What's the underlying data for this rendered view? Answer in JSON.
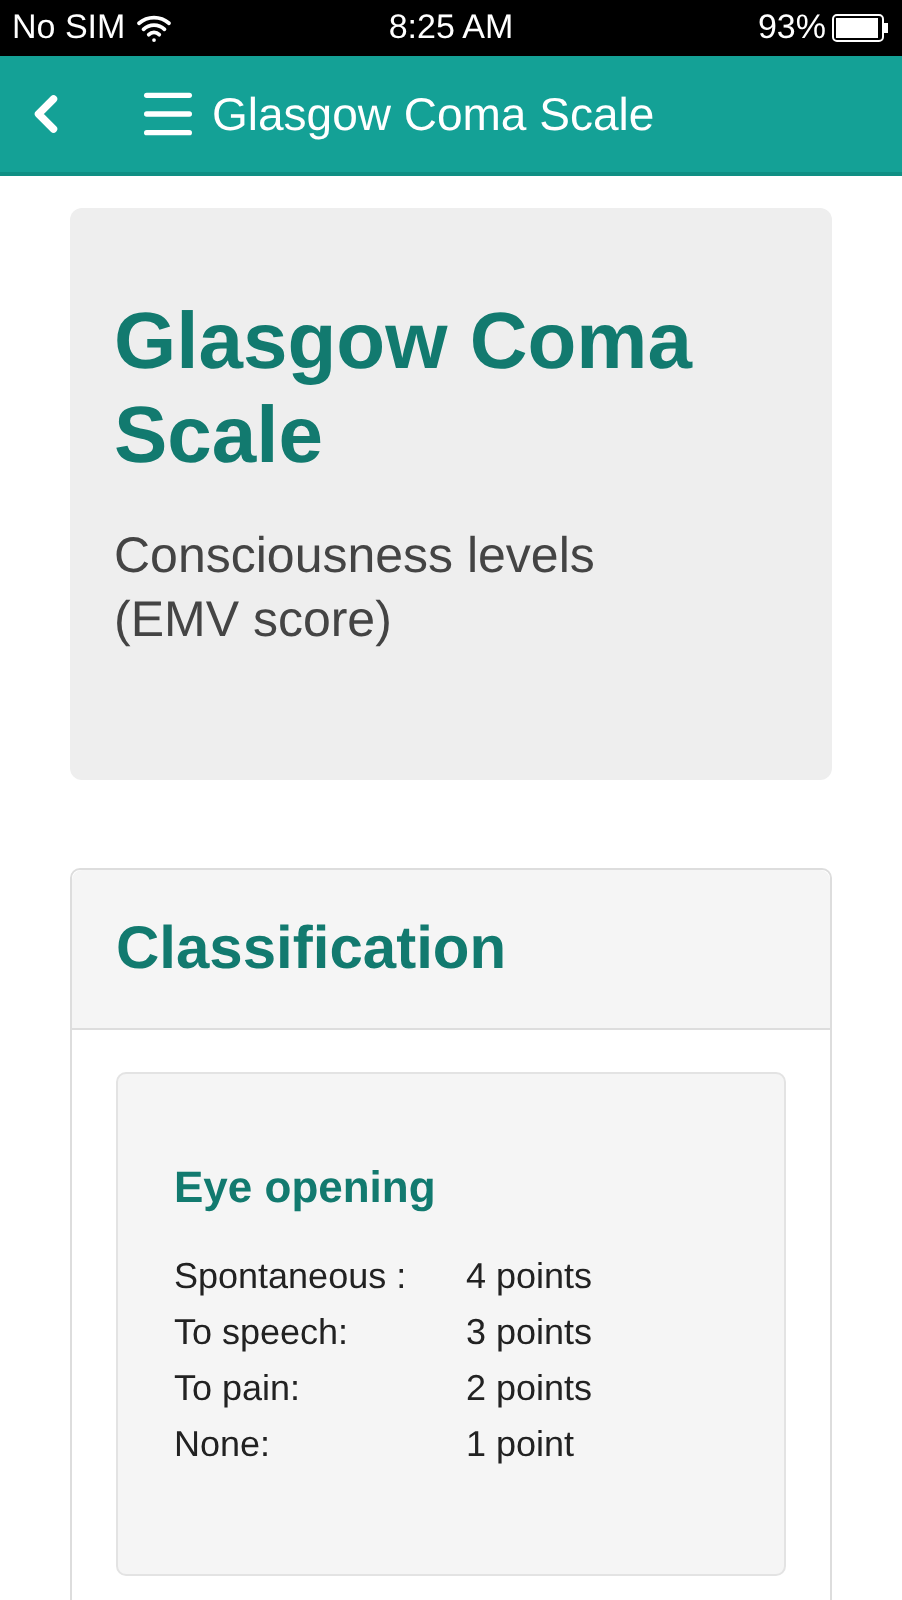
{
  "status_bar": {
    "carrier": "No SIM",
    "time": "8:25 AM",
    "battery": "93%"
  },
  "nav_bar": {
    "title": "Glasgow Coma Scale"
  },
  "hero": {
    "title": "Glasgow Coma Scale",
    "subtitle": "Consciousness levels (EMV score)"
  },
  "panel": {
    "title": "Classification",
    "sections": [
      {
        "title": "Eye opening",
        "rows": [
          {
            "label": "Spontaneous :",
            "value": "4 points"
          },
          {
            "label": "To speech:",
            "value": "3 points"
          },
          {
            "label": "To pain:",
            "value": "2 points"
          },
          {
            "label": "None:",
            "value": "1 point"
          }
        ]
      }
    ]
  }
}
